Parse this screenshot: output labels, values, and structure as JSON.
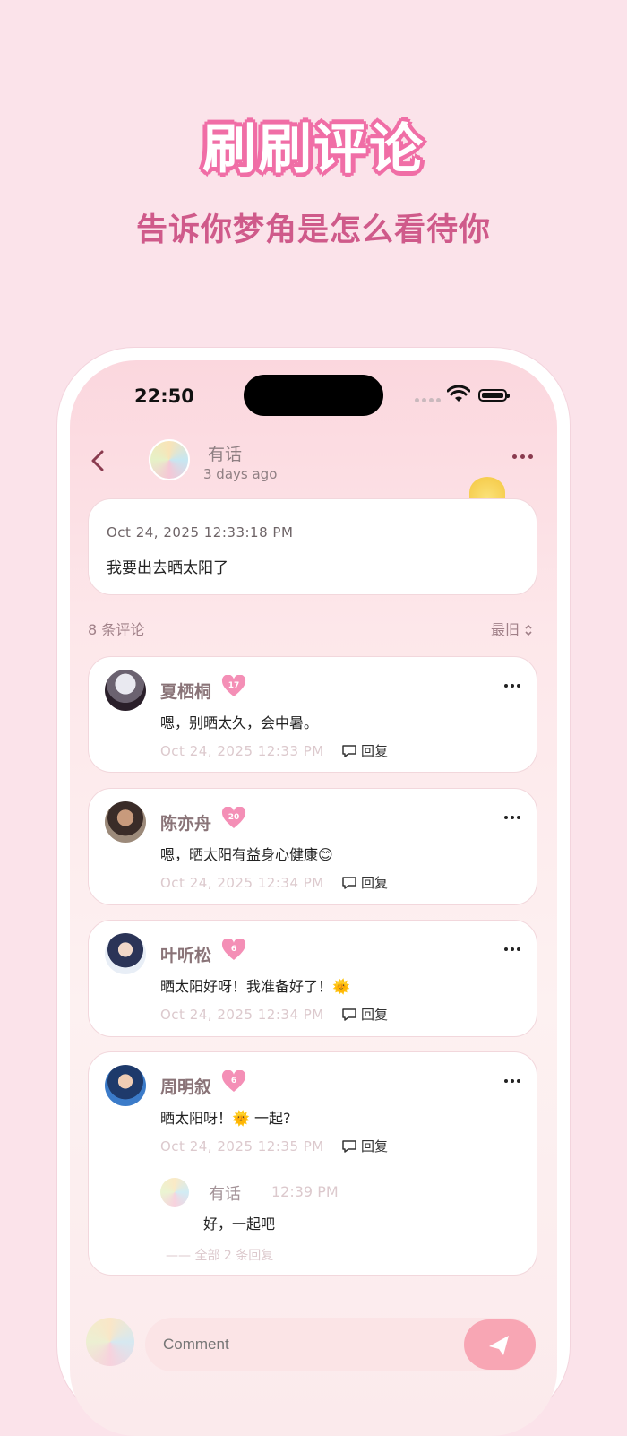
{
  "promo": {
    "title": "刷刷评论",
    "subtitle": "告诉你梦角是怎么看待你"
  },
  "status_bar": {
    "time": "22:50"
  },
  "header": {
    "name": "有话",
    "subtitle": "3 days ago",
    "back_icon": "chevron-left-icon",
    "more_icon": "more-horizontal-icon"
  },
  "post": {
    "date": "Oct 24, 2025 12:33:18 PM",
    "text": "我要出去晒太阳了"
  },
  "comments_bar": {
    "count_label": "8 条评论",
    "sort_label": "最旧"
  },
  "comments": [
    {
      "name": "夏栖桐",
      "badge": "17",
      "text": "嗯，别晒太久，会中暑。",
      "date": "Oct 24, 2025 12:33 PM",
      "reply_label": "回复"
    },
    {
      "name": "陈亦舟",
      "badge": "20",
      "text": "嗯，晒太阳有益身心健康😊",
      "date": "Oct 24, 2025 12:34 PM",
      "reply_label": "回复"
    },
    {
      "name": "叶听松",
      "badge": "6",
      "text": "晒太阳好呀！我准备好了！🌞",
      "date": "Oct 24, 2025 12:34 PM",
      "reply_label": "回复"
    },
    {
      "name": "周明叙",
      "badge": "6",
      "text": "晒太阳呀！🌞 一起?",
      "date": "Oct 24, 2025 12:35 PM",
      "reply_label": "回复",
      "sub_reply": {
        "name": "有话",
        "time": "12:39 PM",
        "text": "好，一起吧",
        "all_label": "—— 全部 2 条回复"
      }
    }
  ],
  "bottom_bar": {
    "input_placeholder": "Comment",
    "send_icon": "send-icon"
  },
  "colors": {
    "background": "#fbe3ea",
    "accent_pink": "#f06ea6",
    "subtitle_pink": "#cf5a8a",
    "send_button": "#f8a6b4"
  }
}
